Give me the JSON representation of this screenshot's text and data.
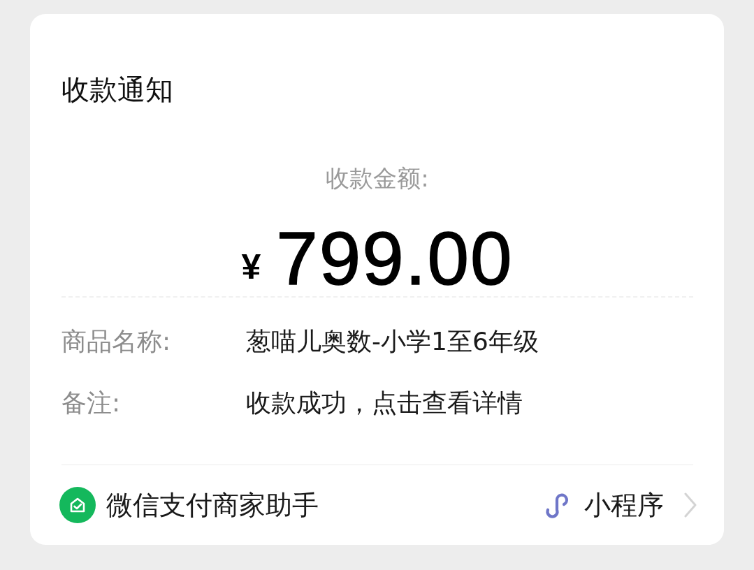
{
  "notification": {
    "title": "收款通知",
    "amount_label": "收款金额:",
    "currency": "¥",
    "amount": "799.00",
    "fields": [
      {
        "label": "商品名称:",
        "value": "葱喵儿奥数-小学1至6年级"
      },
      {
        "label": "备注:",
        "value": "收款成功，点击查看详情"
      }
    ],
    "footer": {
      "source": "微信支付商家助手",
      "link": "小程序"
    }
  }
}
